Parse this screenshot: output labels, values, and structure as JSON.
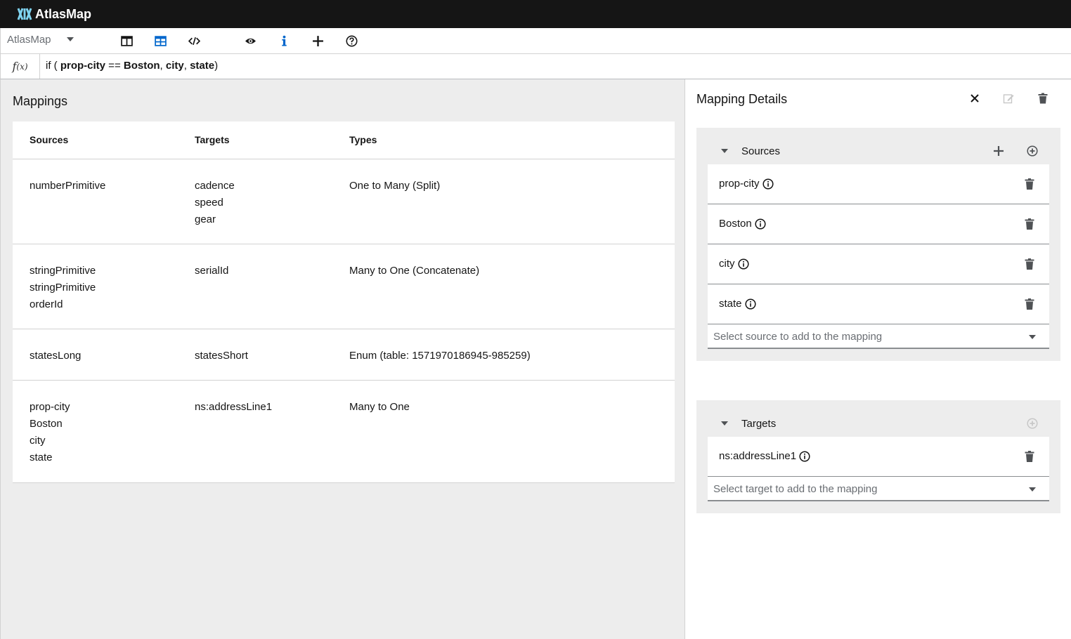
{
  "app": {
    "brand": "AtlasMap"
  },
  "toolbar": {
    "selector_value": "AtlasMap",
    "buttons": [
      {
        "name": "columns-view-icon",
        "color": "#151515"
      },
      {
        "name": "table-view-icon",
        "color": "#06c"
      },
      {
        "name": "code-icon",
        "color": "#151515"
      },
      {
        "name": "eye-icon",
        "color": "#151515"
      },
      {
        "name": "info-icon",
        "color": "#06c"
      },
      {
        "name": "plus-icon",
        "color": "#151515"
      },
      {
        "name": "help-icon",
        "color": "#151515"
      }
    ]
  },
  "expression": {
    "fx_symbol": "f",
    "fx_sub": "(x)",
    "parts": [
      "if ( ",
      "prop-city",
      " == ",
      "Boston",
      ", ",
      "city",
      ", ",
      "state",
      ")"
    ]
  },
  "mappings": {
    "title": "Mappings",
    "columns": {
      "sources": "Sources",
      "targets": "Targets",
      "types": "Types"
    },
    "rows": [
      {
        "sources": [
          "numberPrimitive"
        ],
        "targets": [
          "cadence",
          "speed",
          "gear"
        ],
        "type": "One to Many (Split)"
      },
      {
        "sources": [
          "stringPrimitive",
          "stringPrimitive",
          "orderId"
        ],
        "targets": [
          "serialId"
        ],
        "type": "Many to One (Concatenate)"
      },
      {
        "sources": [
          "statesLong"
        ],
        "targets": [
          "statesShort"
        ],
        "type": "Enum (table: 1571970186945-985259)"
      },
      {
        "sources": [
          "prop-city",
          "Boston",
          "city",
          "state"
        ],
        "targets": [
          "ns:addressLine1"
        ],
        "type": "Many to One"
      }
    ]
  },
  "details": {
    "title": "Mapping Details",
    "sources": {
      "title": "Sources",
      "fields": [
        "prop-city",
        "Boston",
        "city",
        "state"
      ],
      "select_placeholder": "Select source to add to the mapping"
    },
    "targets": {
      "title": "Targets",
      "fields": [
        "ns:addressLine1"
      ],
      "select_placeholder": "Select target to add to the mapping"
    }
  },
  "colors": {
    "topbar": "#151515",
    "accent": "#06c",
    "pane_bg": "#ededed"
  }
}
